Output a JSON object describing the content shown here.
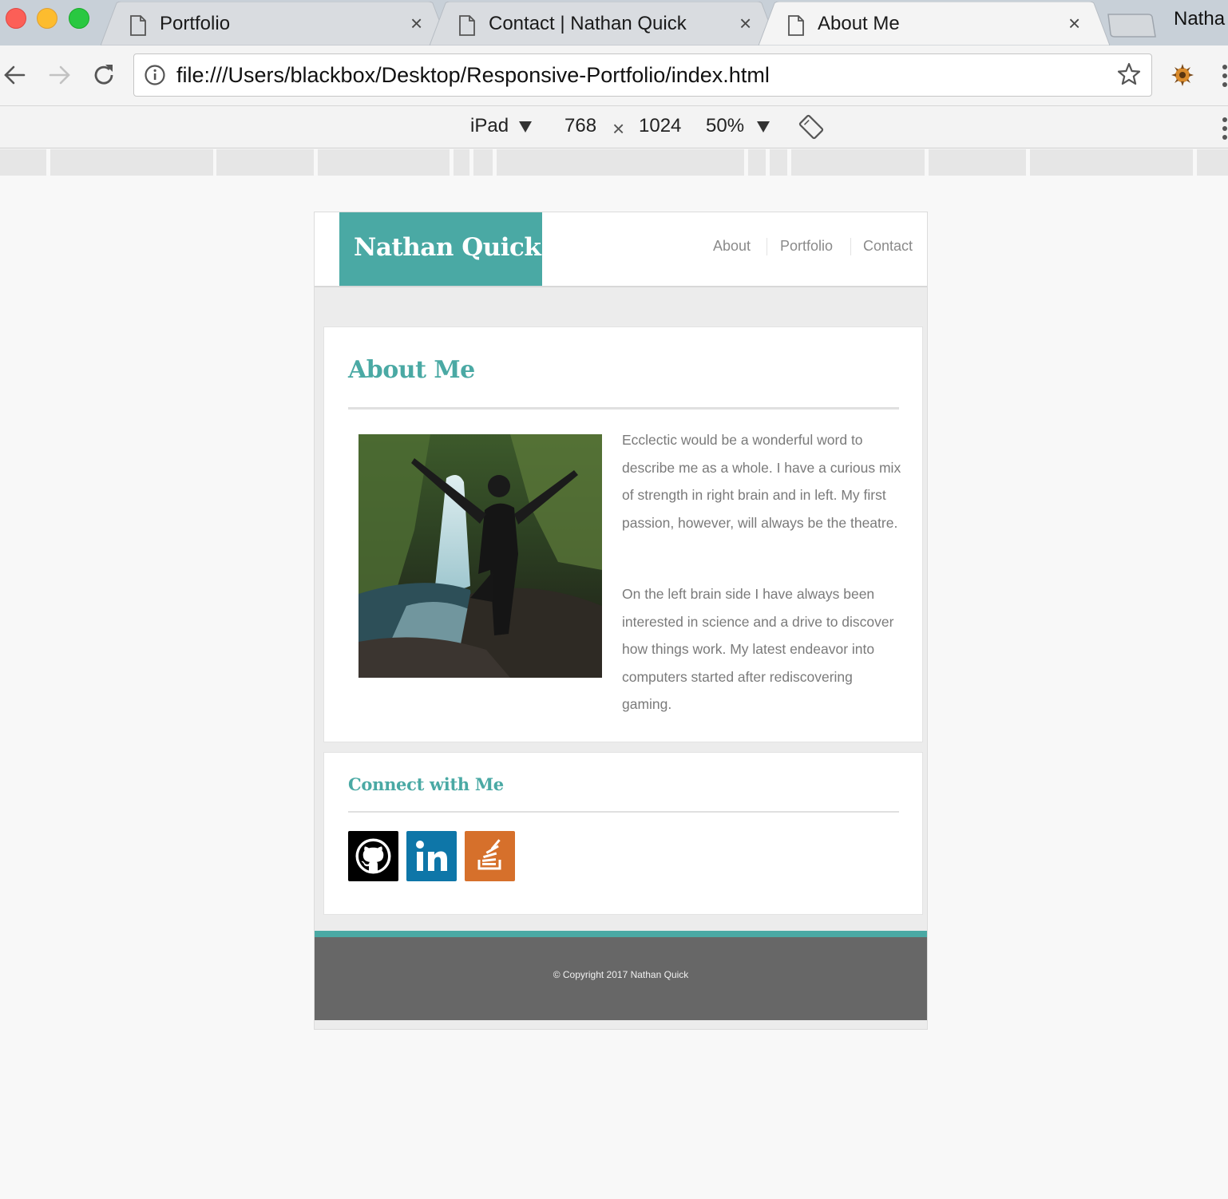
{
  "browser": {
    "tabs": [
      {
        "title": "Portfolio",
        "close": "×"
      },
      {
        "title": "Contact | Nathan Quick",
        "close": "×"
      },
      {
        "title": "About Me",
        "close": "×"
      }
    ],
    "profile_name": "Natha",
    "url": "file:///Users/blackbox/Desktop/Responsive-Portfolio/index.html",
    "device_toolbar": {
      "device": "iPad",
      "width": "768",
      "times": "×",
      "height": "1024",
      "zoom": "50%"
    }
  },
  "site": {
    "logo": "Nathan Quick",
    "nav": [
      "About",
      "Portfolio",
      "Contact"
    ],
    "about": {
      "heading": "About Me",
      "paragraphs": [
        "Ecclectic would be a wonderful word to describe me as a whole. I have a curious mix of strength in right brain and in left. My first passion, however, will always be the theatre.",
        "On the left brain side I have always been interested in science and a drive to discover how things work. My latest endeavor into computers started after rediscovering gaming."
      ]
    },
    "connect": {
      "heading": "Connect with Me",
      "links": [
        {
          "icon": "github-icon",
          "color": "#000000"
        },
        {
          "icon": "linkedin-icon",
          "color": "#0e76a8"
        },
        {
          "icon": "stackoverflow-icon",
          "color": "#d6702b"
        }
      ]
    },
    "footer": "© Copyright 2017 Nathan Quick"
  },
  "colors": {
    "accent": "#4aa9a4",
    "footer_bg": "#676767",
    "body_text": "#7a7a7a"
  }
}
